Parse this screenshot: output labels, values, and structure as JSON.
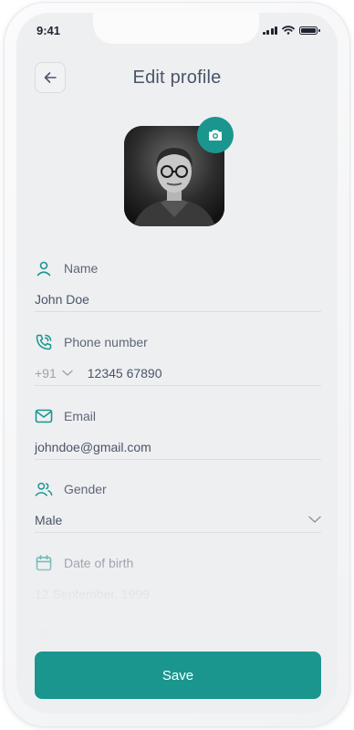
{
  "status_bar": {
    "time": "9:41"
  },
  "header": {
    "title": "Edit profile"
  },
  "colors": {
    "accent": "#1a968f",
    "background": "#eeeff1",
    "text": "#4a5568"
  },
  "avatar": {
    "alt": "profile photo"
  },
  "fields": {
    "name": {
      "label": "Name",
      "value": "John Doe",
      "icon": "user-icon"
    },
    "phone": {
      "label": "Phone number",
      "country_code": "+91",
      "value": "12345 67890",
      "icon": "phone-icon"
    },
    "email": {
      "label": "Email",
      "value": "johndoe@gmail.com",
      "icon": "mail-icon"
    },
    "gender": {
      "label": "Gender",
      "value": "Male",
      "icon": "users-icon"
    },
    "dob": {
      "label": "Date of birth",
      "value": "12 September, 1999",
      "icon": "calendar-icon"
    },
    "address": {
      "icon": "location-icon"
    }
  },
  "save_button": {
    "label": "Save"
  }
}
